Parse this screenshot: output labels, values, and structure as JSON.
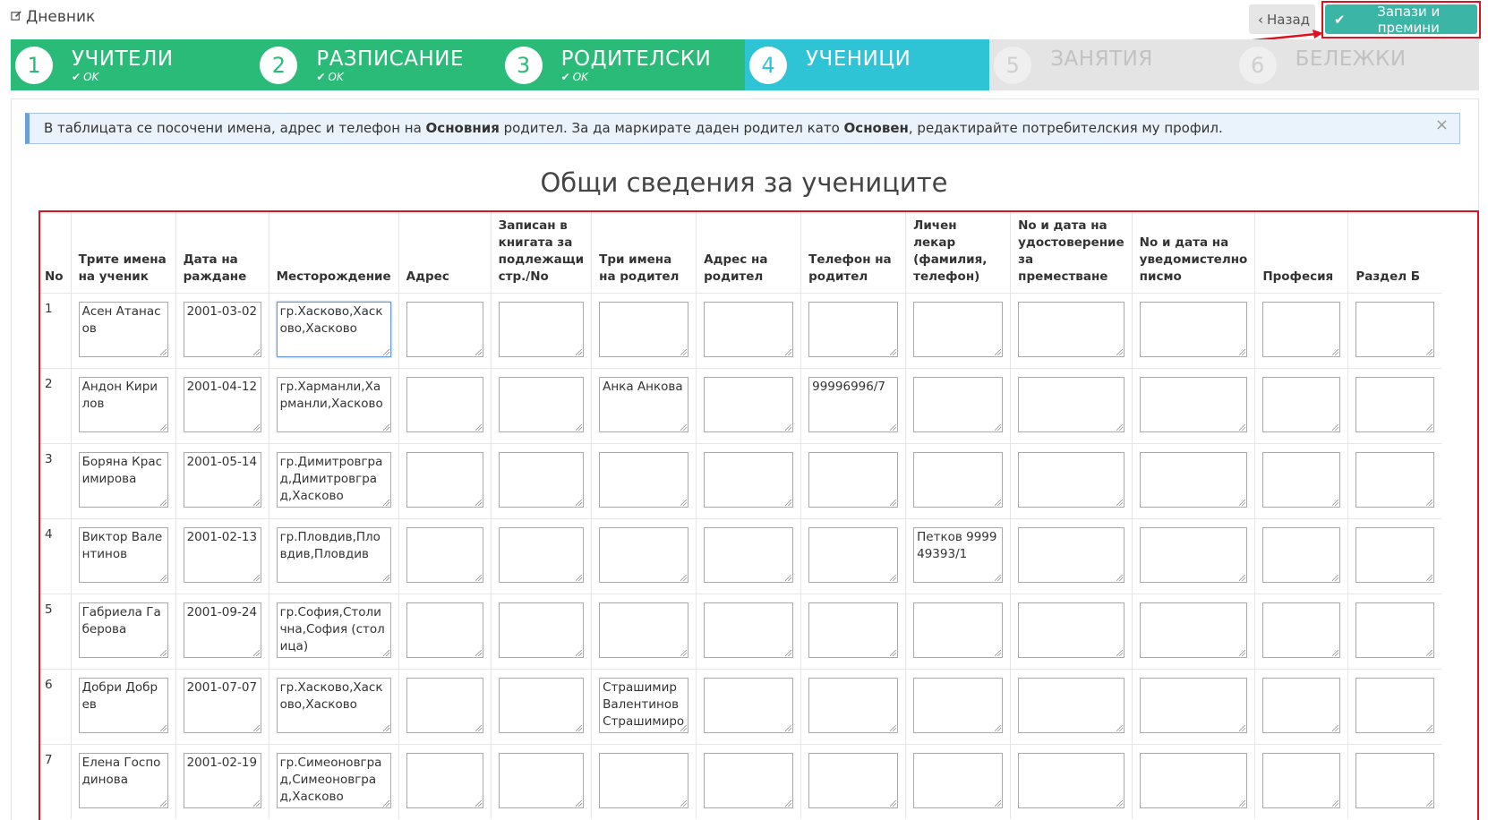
{
  "page": {
    "title": "Дневник"
  },
  "buttons": {
    "back": "Назад",
    "save": "Запази и премини"
  },
  "wizard": {
    "steps": [
      {
        "num": "1",
        "label": "УЧИТЕЛИ",
        "status": "OK"
      },
      {
        "num": "2",
        "label": "РАЗПИСАНИЕ",
        "status": "OK"
      },
      {
        "num": "3",
        "label": "РОДИТЕЛСКИ",
        "status": "OK"
      },
      {
        "num": "4",
        "label": "УЧЕНИЦИ",
        "status": ""
      },
      {
        "num": "5",
        "label": "ЗАНЯТИЯ",
        "status": ""
      },
      {
        "num": "6",
        "label": "БЕЛЕЖКИ",
        "status": ""
      }
    ]
  },
  "alert": {
    "part1": "В таблицата се посочени имена, адрес и телефон на ",
    "bold1": "Основния",
    "part2": " родител. За да маркирате даден родител като ",
    "bold2": "Основен",
    "part3": ", редактирайте потребителския му профил.",
    "close": "×"
  },
  "section_title": "Общи сведения за учениците",
  "table": {
    "headers": [
      "No",
      "Трите имена на ученик",
      "Дата на раждане",
      "Месторождение",
      "Адрес",
      "Записан в книгата за подлежащи стр./No",
      "Три имена на родител",
      "Адрес на родител",
      "Телефон на родител",
      "Личен лекар (фамилия, телефон)",
      "No и дата на удостоверение за преместване",
      "No и дата на уведомистелно писмо",
      "Професия",
      "Раздел Б"
    ],
    "rows": [
      {
        "no": "1",
        "cells": [
          "Асен Атанасов",
          "2001-03-02",
          "гр.Хасково,Хасково,Хасково",
          "",
          "",
          "",
          "",
          "",
          "",
          "",
          "",
          "",
          ""
        ]
      },
      {
        "no": "2",
        "cells": [
          "Андон Кирилов",
          "2001-04-12",
          "гр.Харманли,Харманли,Хасково",
          "",
          "",
          "Анка  Анкова",
          "",
          "99996996/7",
          "",
          "",
          "",
          "",
          ""
        ]
      },
      {
        "no": "3",
        "cells": [
          "Боряна Красимирова",
          "2001-05-14",
          "гр.Димитровград,Димитровград,Хасково",
          "",
          "",
          "",
          "",
          "",
          "",
          "",
          "",
          "",
          ""
        ]
      },
      {
        "no": "4",
        "cells": [
          "Виктор Валентинов",
          "2001-02-13",
          "гр.Пловдив,Пловдив,Пловдив",
          "",
          "",
          "",
          "",
          "",
          "Петков 999949393/1",
          "",
          "",
          "",
          ""
        ]
      },
      {
        "no": "5",
        "cells": [
          "Габриела Габерова",
          "2001-09-24",
          "гр.София,Столична,София (столица)",
          "",
          "",
          "",
          "",
          "",
          "",
          "",
          "",
          "",
          ""
        ]
      },
      {
        "no": "6",
        "cells": [
          "Добри Добрев",
          "2001-07-07",
          "гр.Хасково,Хасково,Хасково",
          "",
          "",
          "Страшимир Валентинов Страшимиров",
          "",
          "",
          "",
          "",
          "",
          "",
          ""
        ]
      },
      {
        "no": "7",
        "cells": [
          "Елена Господинова",
          "2001-02-19",
          "гр.Симеоновград,Симеоновград,Хасково",
          "",
          "",
          "",
          "",
          "",
          "",
          "",
          "",
          "",
          ""
        ]
      }
    ]
  },
  "colors": {
    "done": "#2abb79",
    "active": "#2fc3d6",
    "todo": "#e4e4e4",
    "save_button": "#3bb6a6",
    "annotation": "#e0101e"
  }
}
